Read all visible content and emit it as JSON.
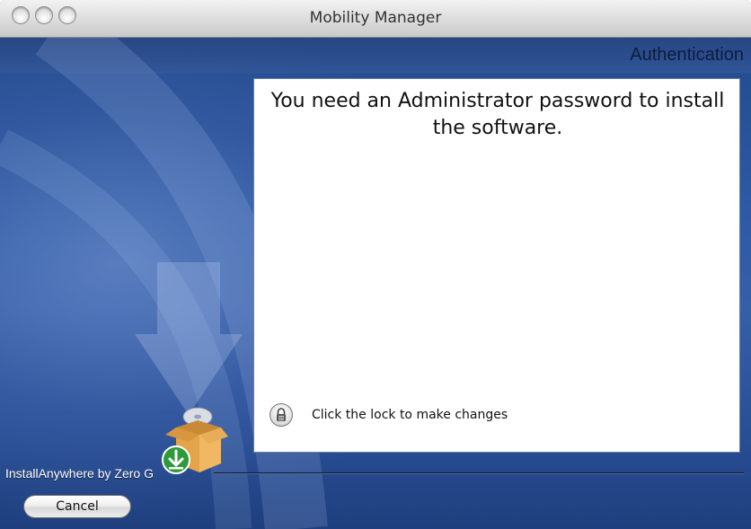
{
  "window": {
    "title": "Mobility Manager"
  },
  "installer": {
    "step_title": "Authentication",
    "heading": "You need an Administrator password to install the software.",
    "lock_label": "Click the lock to make changes",
    "vendor_label": "InstallAnywhere by Zero G",
    "cancel_label": "Cancel"
  },
  "icons": {
    "window_controls": [
      "close-icon",
      "minimize-icon",
      "zoom-icon"
    ],
    "lock": "lock-icon",
    "installer_box": "installer-box-icon",
    "download_arrow": "download-arrow-icon"
  },
  "colors": {
    "background_blue": "#2d5aa3",
    "panel": "#ffffff",
    "download_green": "#2e9a3a",
    "box_orange": "#e3a44a"
  }
}
